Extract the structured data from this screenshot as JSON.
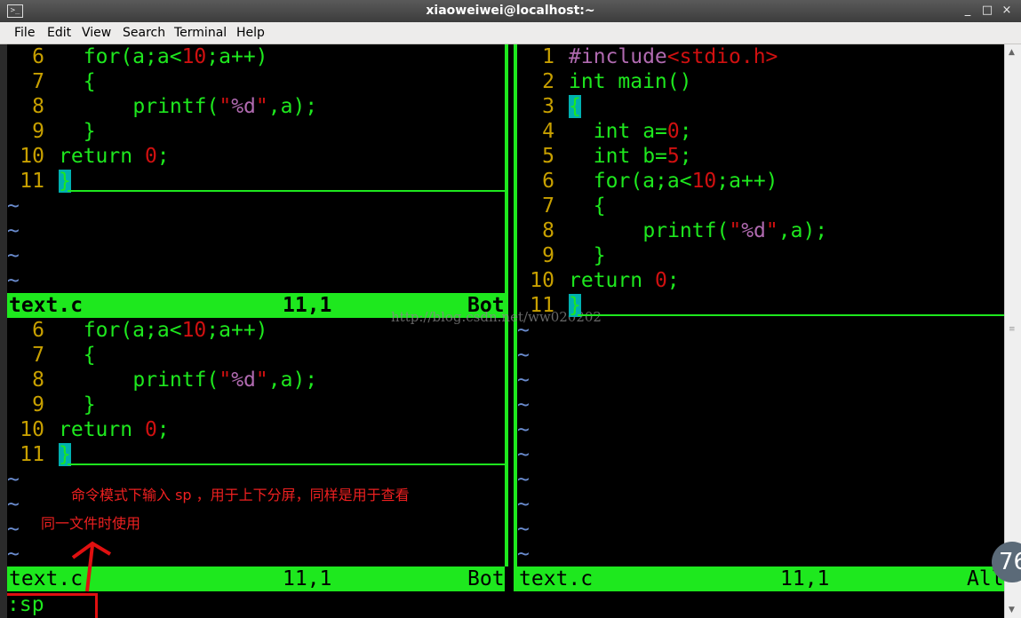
{
  "window": {
    "title": "xiaoweiwei@localhost:~",
    "terminal_icon": "terminal-icon",
    "controls": {
      "minimize": "_",
      "maximize": "□",
      "close": "×"
    }
  },
  "menu": [
    "File",
    "Edit",
    "View",
    "Search",
    "Terminal",
    "Help"
  ],
  "panes": {
    "top_left": {
      "lines": [
        {
          "num": "6",
          "code": "for(a;a<10;a++)"
        },
        {
          "num": "7",
          "code": "{"
        },
        {
          "num": "8",
          "code": "printf(\"%d\",a);"
        },
        {
          "num": "9",
          "code": "}"
        },
        {
          "num": "10",
          "code": "return 0;"
        },
        {
          "num": "11",
          "code": "}"
        }
      ],
      "tilde": "~",
      "status": {
        "file": "text.c",
        "pos": "11,1",
        "scroll": "Bot"
      }
    },
    "bottom_left": {
      "lines": [
        {
          "num": "6",
          "code": "for(a;a<10;a++)"
        },
        {
          "num": "7",
          "code": "{"
        },
        {
          "num": "8",
          "code": "printf(\"%d\",a);"
        },
        {
          "num": "9",
          "code": "}"
        },
        {
          "num": "10",
          "code": "return 0;"
        },
        {
          "num": "11",
          "code": "}"
        }
      ],
      "tilde": "~",
      "status": {
        "file": "text.c",
        "pos": "11,1",
        "scroll": "Bot"
      }
    },
    "right": {
      "lines": [
        {
          "num": "1",
          "code": "#include<stdio.h>"
        },
        {
          "num": "2",
          "code": "int main()"
        },
        {
          "num": "3",
          "code": "{"
        },
        {
          "num": "4",
          "code": "int a=0;"
        },
        {
          "num": "5",
          "code": "int b=5;"
        },
        {
          "num": "6",
          "code": "for(a;a<10;a++)"
        },
        {
          "num": "7",
          "code": "{"
        },
        {
          "num": "8",
          "code": "printf(\"%d\",a);"
        },
        {
          "num": "9",
          "code": "}"
        },
        {
          "num": "10",
          "code": "return 0;"
        },
        {
          "num": "11",
          "code": "}"
        }
      ],
      "tilde": "~",
      "status": {
        "file": "text.c",
        "pos": "11,1",
        "scroll": "All"
      }
    }
  },
  "command_line": ":sp",
  "annotation": {
    "line1": "命令模式下输入 sp ，用于上下分屏，同样是用于查看",
    "line2": "同一文件时使用"
  },
  "watermark": "http://blog.csdn.net/ww020202",
  "overlay_badge": "76",
  "colors": {
    "vim_green": "#1ee81e",
    "line_number": "#c8a000",
    "constant_red": "#d01010",
    "string_purple": "#b06ab0",
    "annotation_red": "#e01010"
  }
}
